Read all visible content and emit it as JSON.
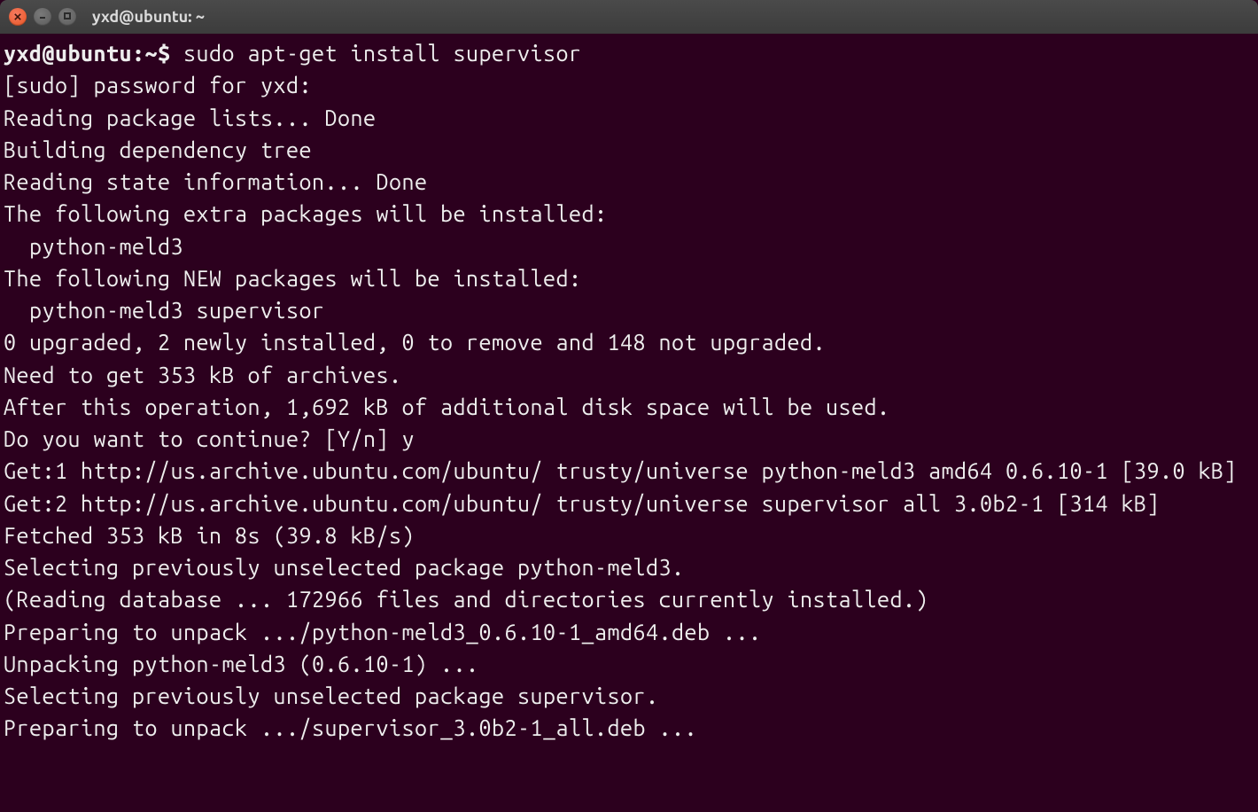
{
  "titlebar": {
    "title": "yxd@ubuntu: ~"
  },
  "terminal": {
    "prompt": "yxd@ubuntu:~$ ",
    "command": "sudo apt-get install supervisor",
    "lines": [
      "[sudo] password for yxd:",
      "Reading package lists... Done",
      "Building dependency tree",
      "Reading state information... Done",
      "The following extra packages will be installed:",
      "  python-meld3",
      "The following NEW packages will be installed:",
      "  python-meld3 supervisor",
      "0 upgraded, 2 newly installed, 0 to remove and 148 not upgraded.",
      "Need to get 353 kB of archives.",
      "After this operation, 1,692 kB of additional disk space will be used.",
      "Do you want to continue? [Y/n] y",
      "Get:1 http://us.archive.ubuntu.com/ubuntu/ trusty/universe python-meld3 amd64 0.6.10-1 [39.0 kB]",
      "Get:2 http://us.archive.ubuntu.com/ubuntu/ trusty/universe supervisor all 3.0b2-1 [314 kB]",
      "Fetched 353 kB in 8s (39.8 kB/s)",
      "Selecting previously unselected package python-meld3.",
      "(Reading database ... 172966 files and directories currently installed.)",
      "Preparing to unpack .../python-meld3_0.6.10-1_amd64.deb ...",
      "Unpacking python-meld3 (0.6.10-1) ...",
      "Selecting previously unselected package supervisor.",
      "Preparing to unpack .../supervisor_3.0b2-1_all.deb ..."
    ]
  }
}
